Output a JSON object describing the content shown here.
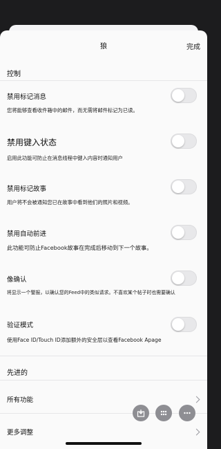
{
  "nav": {
    "title": "狼",
    "done_label": "完成"
  },
  "section_control": "控制",
  "settings": [
    {
      "label": "禁用标记消息",
      "desc": "您将能够查看收件箱中的邮件，而无需将邮件标记为已读。",
      "enabled": false
    },
    {
      "label": "禁用键入状态",
      "desc": "启用此功能可防止在消息线程中键入内容时通知用户",
      "enabled": false
    },
    {
      "label": "禁用标记故事",
      "desc": "用户将不会被通知您已在故事中看到他们的照片和视频。",
      "enabled": false
    },
    {
      "label": "禁用自动前进",
      "desc": "此功能可防止Facebook故事在完成后移动到下一个故事。",
      "enabled": false
    },
    {
      "label": "像确认",
      "desc": "将显示一个警报，以确认您的Feed中的类似请求。不喜欢某个帖子时也需要确认",
      "enabled": false
    },
    {
      "label": "验证模式",
      "desc": "使用Face ID/Touch ID添加额外的安全层以查看Facebook Apage",
      "enabled": false
    }
  ],
  "section_advanced": "先进的",
  "links": [
    {
      "label": "所有功能"
    },
    {
      "label": "更多调整"
    }
  ],
  "fabs": [
    {
      "icon": "download-icon"
    },
    {
      "icon": "grid-icon"
    },
    {
      "icon": "more-icon"
    }
  ]
}
